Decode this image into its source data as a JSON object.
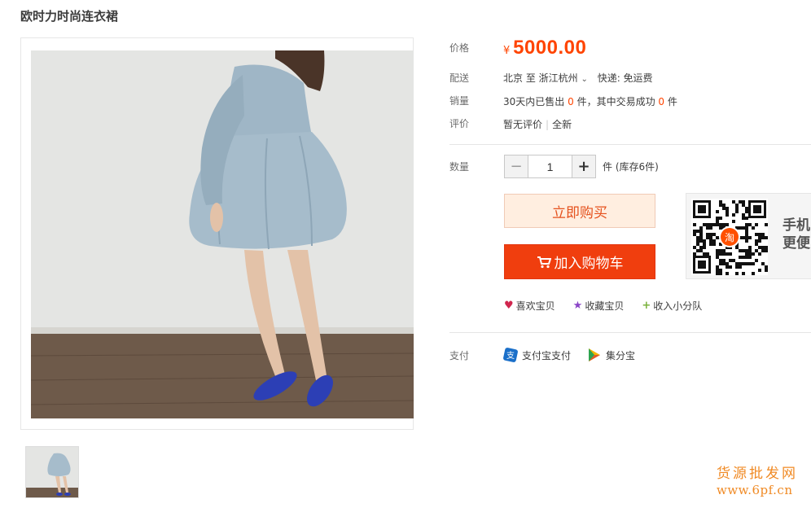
{
  "product": {
    "title": "欧时力时尚连衣裙"
  },
  "details": {
    "price_label": "价格",
    "price_symbol": "¥",
    "price_value": "5000.00",
    "delivery_label": "配送",
    "delivery_from": "北京 至 浙江杭州",
    "delivery_express": "快递: 免运费",
    "sales_label": "销量",
    "sales_prefix": "30天内已售出",
    "sales_count": "0",
    "sales_mid": "件，其中交易成功",
    "sales_success": "0",
    "sales_suffix": "件",
    "review_label": "评价",
    "review_text": "暂无评价",
    "review_condition": "全新",
    "quantity_label": "数量",
    "quantity_value": "1",
    "stock_text": "件 (库存6件)"
  },
  "buttons": {
    "buy_now": "立即购买",
    "add_to_cart": "加入购物车"
  },
  "actions": {
    "like": "喜欢宝贝",
    "favorite": "收藏宝贝",
    "squad": "收入小分队"
  },
  "qr": {
    "line1": "手机",
    "line2": "更便"
  },
  "payment": {
    "label": "支付",
    "alipay": "支付宝支付",
    "jifenbao": "集分宝"
  },
  "watermark": {
    "line1": "货源批发网",
    "line2": "www.6pf.cn"
  },
  "colors": {
    "accent": "#ff4400",
    "cart_button": "#f03e0e",
    "buy_button_bg": "#ffeee0"
  }
}
